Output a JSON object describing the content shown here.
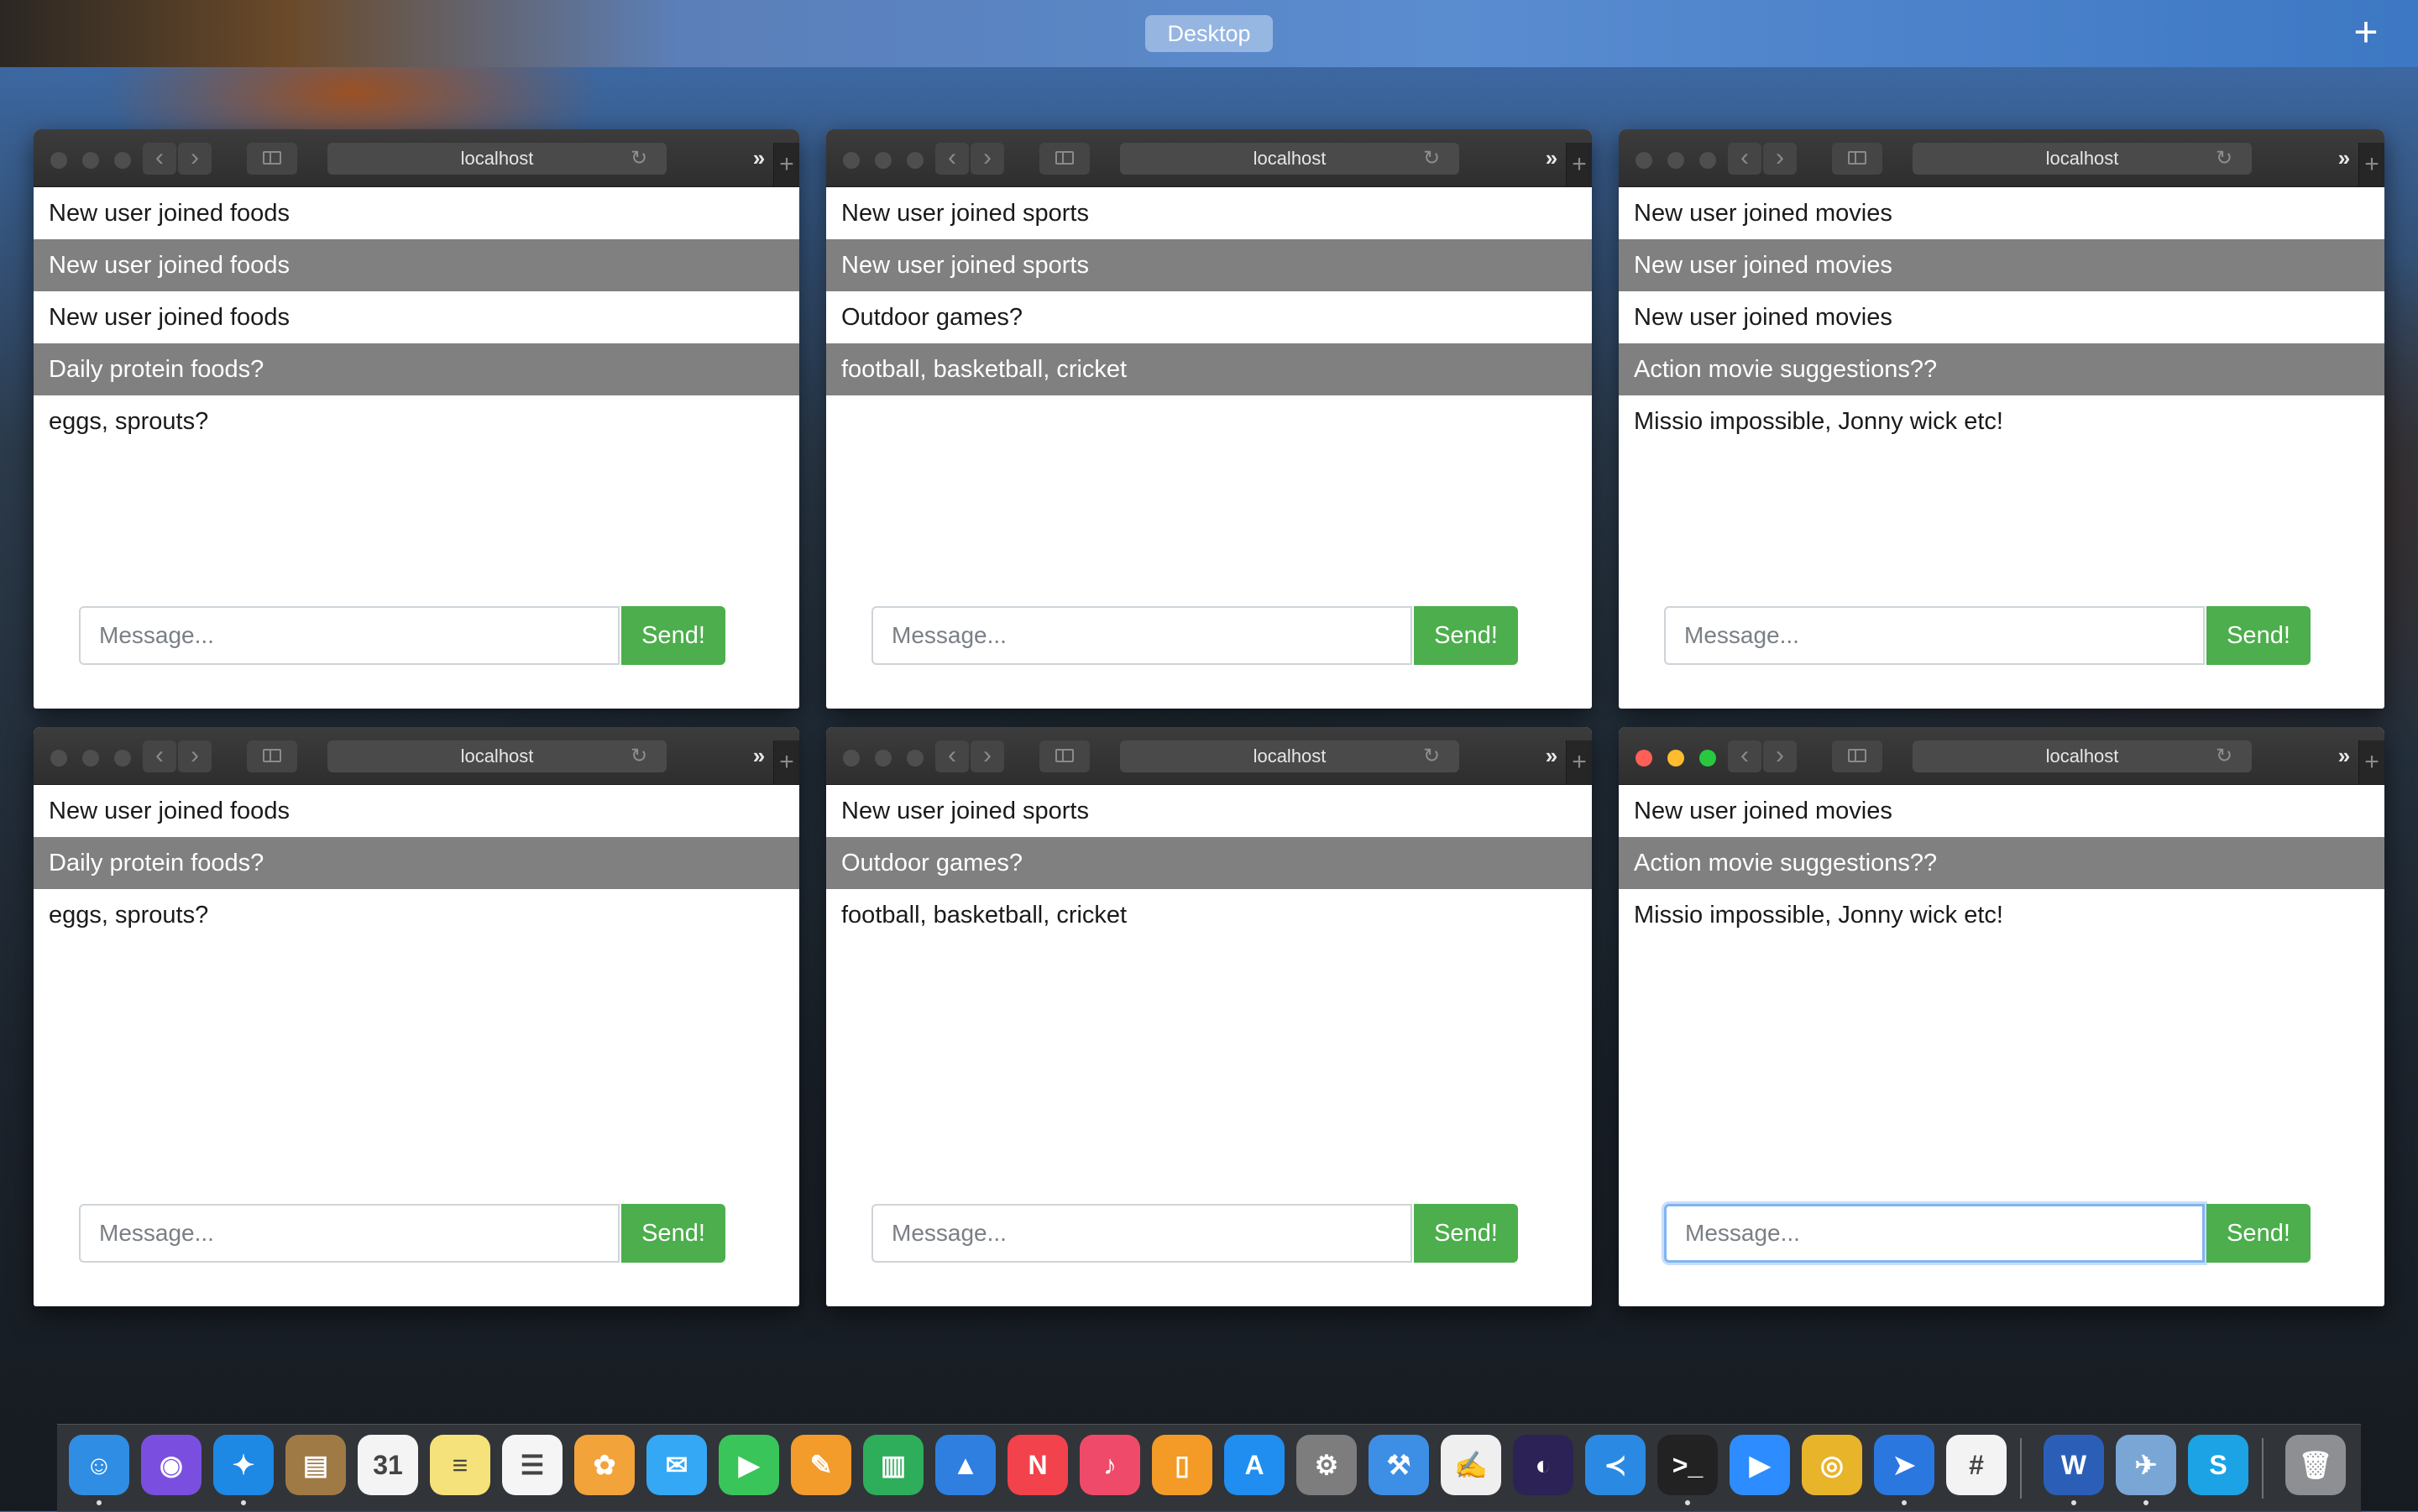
{
  "desktop": {
    "space_label": "Desktop",
    "add_space_icon": "+"
  },
  "browser_windows": [
    {
      "name": "window-foods-1",
      "url": "localhost",
      "messages": [
        "New user joined foods",
        "New user joined foods",
        "New user joined foods",
        "Daily protein foods?",
        "eggs, sprouts?"
      ],
      "placeholder": "Message...",
      "send_label": "Send!"
    },
    {
      "name": "window-sports-1",
      "url": "localhost",
      "messages": [
        "New user joined sports",
        "New user joined sports",
        "Outdoor games?",
        "football, basketball, cricket"
      ],
      "placeholder": "Message...",
      "send_label": "Send!"
    },
    {
      "name": "window-movies-1",
      "url": "localhost",
      "messages": [
        "New user joined movies",
        "New user joined movies",
        "New user joined movies",
        "Action movie suggestions??",
        "Missio impossible, Jonny wick etc!"
      ],
      "placeholder": "Message...",
      "send_label": "Send!"
    },
    {
      "name": "window-foods-2",
      "url": "localhost",
      "messages": [
        "New user joined foods",
        "Daily protein foods?",
        "eggs, sprouts?"
      ],
      "placeholder": "Message...",
      "send_label": "Send!"
    },
    {
      "name": "window-sports-2",
      "url": "localhost",
      "messages": [
        "New user joined sports",
        "Outdoor games?",
        "football, basketball, cricket"
      ],
      "placeholder": "Message...",
      "send_label": "Send!"
    },
    {
      "name": "window-movies-2",
      "url": "localhost",
      "messages": [
        "New user joined movies",
        "Action movie suggestions??",
        "Missio impossible, Jonny wick etc!"
      ],
      "placeholder": "Message...",
      "send_label": "Send!",
      "active": true
    }
  ],
  "toolbar": {
    "back_icon": "‹",
    "forward_icon": "›",
    "reload_icon": "↻",
    "more_icon": "»",
    "new_tab_icon": "+"
  },
  "dock": {
    "apps": [
      {
        "icon": "finder-icon",
        "glyph": "☺",
        "color": "#2f8de4"
      },
      {
        "icon": "siri-icon",
        "glyph": "◉",
        "color": "#7a4fe0"
      },
      {
        "icon": "safari-icon",
        "glyph": "✦",
        "color": "#1e88e5"
      },
      {
        "icon": "contacts-icon",
        "glyph": "▤",
        "color": "#a07a45"
      },
      {
        "icon": "calendar-icon",
        "glyph": "31",
        "color": "#f4f4f4"
      },
      {
        "icon": "notes-icon",
        "glyph": "≡",
        "color": "#f6e27a"
      },
      {
        "icon": "reminders-icon",
        "glyph": "☰",
        "color": "#f5f5f5"
      },
      {
        "icon": "photos-icon",
        "glyph": "✿",
        "color": "#f2a33a"
      },
      {
        "icon": "messages-icon",
        "glyph": "✉",
        "color": "#35a8f5"
      },
      {
        "icon": "facetime-icon",
        "glyph": "▶",
        "color": "#3ac55a"
      },
      {
        "icon": "pages-icon",
        "glyph": "✎",
        "color": "#f39c2b"
      },
      {
        "icon": "numbers-icon",
        "glyph": "▥",
        "color": "#2eae5a"
      },
      {
        "icon": "keynote-icon",
        "glyph": "▲",
        "color": "#2f7fe0"
      },
      {
        "icon": "news-icon",
        "glyph": "N",
        "color": "#f2424b"
      },
      {
        "icon": "music-icon",
        "glyph": "♪",
        "color": "#f04a6a"
      },
      {
        "icon": "books-icon",
        "glyph": "▯",
        "color": "#f39b26"
      },
      {
        "icon": "app-store-icon",
        "glyph": "A",
        "color": "#1f8ef0"
      },
      {
        "icon": "system-preferences-icon",
        "glyph": "⚙",
        "color": "#7d7d7d"
      },
      {
        "icon": "xcode-icon",
        "glyph": "⚒",
        "color": "#3d8fe6"
      },
      {
        "icon": "textedit-icon",
        "glyph": "✍",
        "color": "#efefef"
      },
      {
        "icon": "eclipse-icon",
        "glyph": "◐",
        "color": "#2c2255"
      },
      {
        "icon": "vscode-icon",
        "glyph": "≺",
        "color": "#2a8ae3"
      },
      {
        "icon": "terminal-icon",
        "glyph": ">_",
        "color": "#222222"
      },
      {
        "icon": "zoom-icon",
        "glyph": "▶",
        "color": "#2d8cff"
      },
      {
        "icon": "chrome-icon",
        "glyph": "◎",
        "color": "#e8b42a"
      },
      {
        "icon": "direct-icon",
        "glyph": "➤",
        "color": "#2a77e0"
      },
      {
        "icon": "slack-icon",
        "glyph": "#",
        "color": "#f3f3f3"
      },
      {
        "icon": "word-icon",
        "glyph": "W",
        "color": "#2b5fb7"
      },
      {
        "icon": "preview-icon",
        "glyph": "✈",
        "color": "#7aa6d6"
      },
      {
        "icon": "skype-icon",
        "glyph": "S",
        "color": "#1ba3e6"
      },
      {
        "icon": "trash-icon",
        "glyph": "🗑",
        "color": "#8d8f93"
      }
    ]
  }
}
